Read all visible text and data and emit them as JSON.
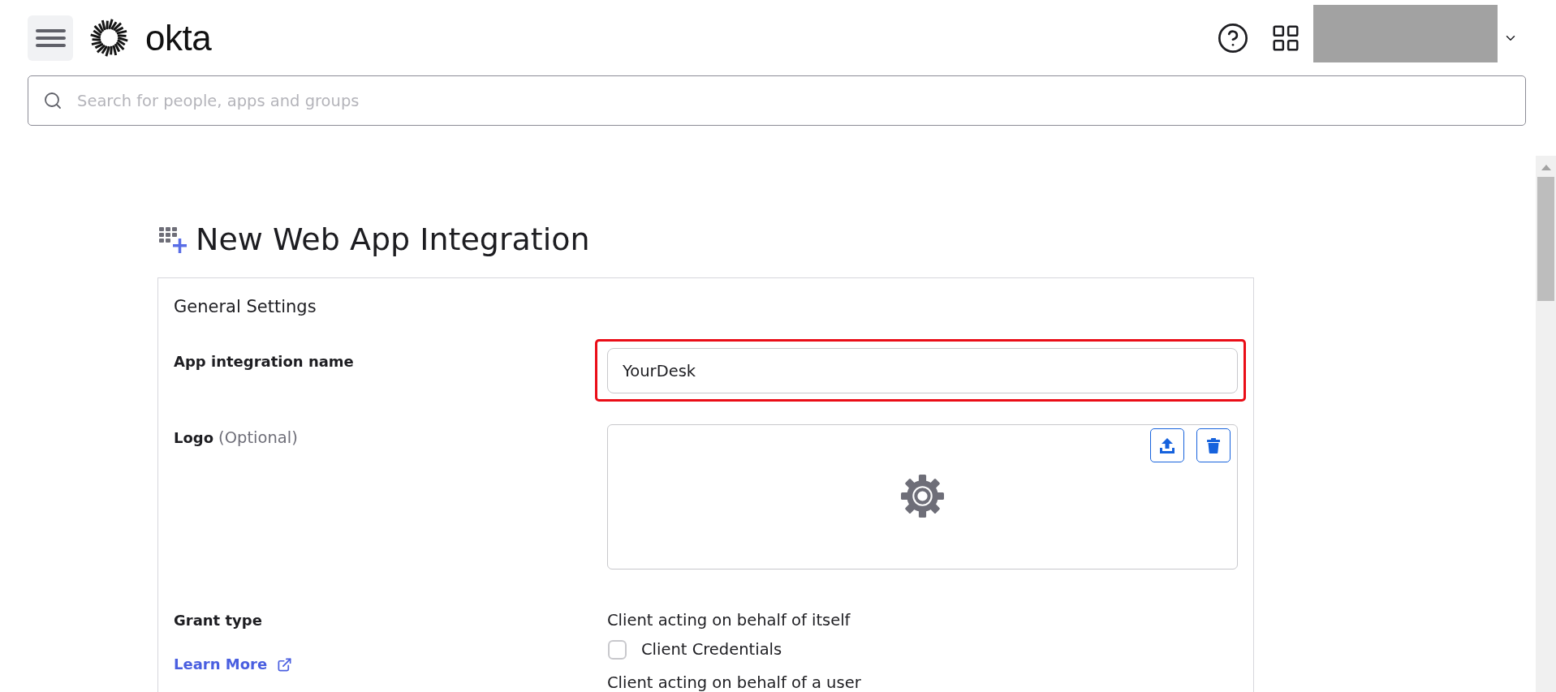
{
  "header": {
    "logo_text": "okta",
    "search": {
      "placeholder": "Search for people, apps and groups"
    }
  },
  "page": {
    "title": "New Web App Integration"
  },
  "card": {
    "heading": "General Settings",
    "fields": [
      {
        "kind": "text",
        "label": "App integration name",
        "value": "YourDesk",
        "highlighted": true
      },
      {
        "kind": "logo",
        "label": "Logo",
        "hint": "(Optional)"
      },
      {
        "kind": "grant",
        "label": "Grant type",
        "link": "Learn More",
        "groups": [
          {
            "heading": "Client acting on behalf of itself",
            "options": [
              {
                "label": "Client Credentials",
                "checked": false
              }
            ]
          },
          {
            "heading": "Client acting on behalf of a user"
          }
        ]
      }
    ]
  }
}
